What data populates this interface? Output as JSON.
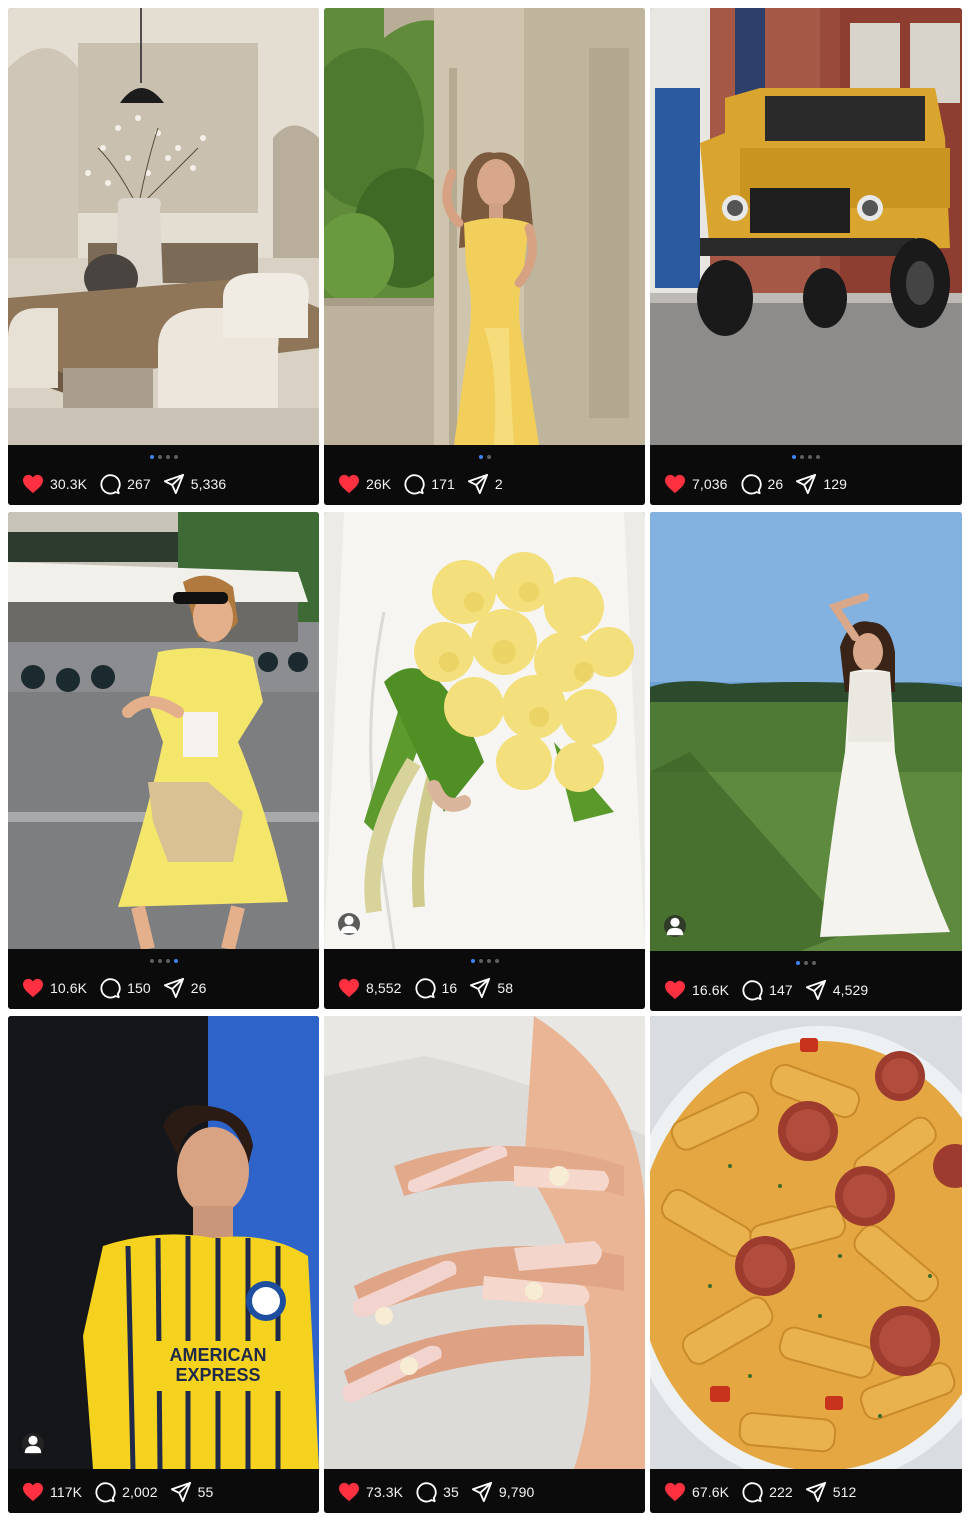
{
  "colors": {
    "like": "#ff3040",
    "bar": "#0b0b0c",
    "dot_active": "#3d82f6",
    "dot": "#5e5e62"
  },
  "icons": {
    "like": "heart-icon",
    "comment": "comment-bubble-icon",
    "share": "send-plane-icon",
    "tag": "person-tag-icon"
  },
  "posts": [
    {
      "subject": "dining-room",
      "likes": "30.3K",
      "comments": "267",
      "shares": "5,336",
      "dots": 4,
      "active_dot": 0,
      "tagged": false
    },
    {
      "subject": "yellow-gown-archway",
      "likes": "26K",
      "comments": "171",
      "shares": "2",
      "dots": 2,
      "active_dot": 0,
      "tagged": false
    },
    {
      "subject": "yellow-defender-truck",
      "likes": "7,036",
      "comments": "26",
      "shares": "129",
      "dots": 4,
      "active_dot": 0,
      "tagged": false
    },
    {
      "subject": "yellow-dress-street",
      "likes": "10.6K",
      "comments": "150",
      "shares": "26",
      "dots": 4,
      "active_dot": 3,
      "tagged": false
    },
    {
      "subject": "yellow-flower-bouquet",
      "likes": "8,552",
      "comments": "16",
      "shares": "58",
      "dots": 4,
      "active_dot": 0,
      "tagged": true
    },
    {
      "subject": "white-gown-field",
      "likes": "16.6K",
      "comments": "147",
      "shares": "4,529",
      "dots": 3,
      "active_dot": 0,
      "tagged": true
    },
    {
      "subject": "football-jersey-portrait",
      "jersey_text": "AMERICAN EXPRESS",
      "likes": "117K",
      "comments": "2,002",
      "shares": "55",
      "dots": 0,
      "active_dot": 0,
      "tagged": true
    },
    {
      "subject": "manicure-nails",
      "likes": "73.3K",
      "comments": "35",
      "shares": "9,790",
      "dots": 0,
      "active_dot": 0,
      "tagged": false
    },
    {
      "subject": "rigatoni-pasta",
      "likes": "67.6K",
      "comments": "222",
      "shares": "512",
      "dots": 0,
      "active_dot": 0,
      "tagged": false
    }
  ]
}
